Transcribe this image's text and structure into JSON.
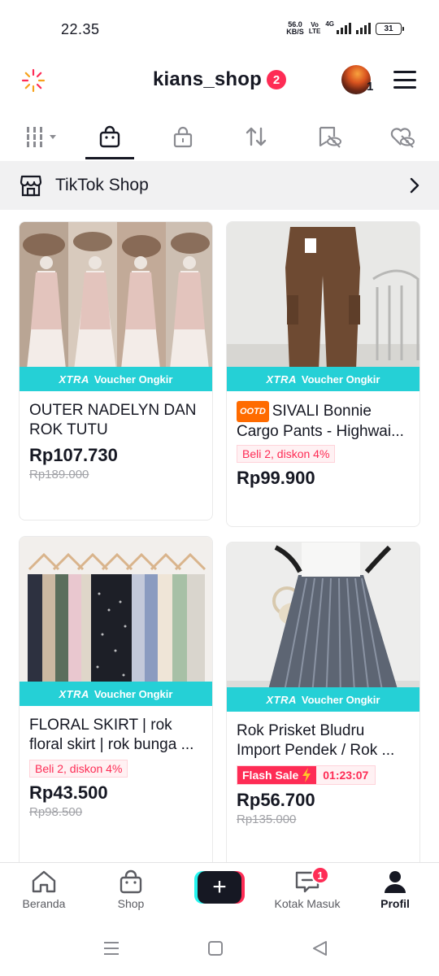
{
  "status_bar": {
    "time": "22.35",
    "net_speed_value": "56.0",
    "net_speed_unit": "KB/S",
    "volte_top": "Vo",
    "volte_bottom": "LTE",
    "network": "4G",
    "battery": "31"
  },
  "header": {
    "title": "kians_shop",
    "notification_count": "2",
    "account_count": "1"
  },
  "tabs": [
    {
      "icon": "grid-icon"
    },
    {
      "icon": "shopping-bag-icon",
      "active": true
    },
    {
      "icon": "lock-icon"
    },
    {
      "icon": "repost-icon"
    },
    {
      "icon": "favorites-hidden-icon"
    },
    {
      "icon": "liked-hidden-icon"
    }
  ],
  "shop_row": {
    "label": "TikTok Shop",
    "icon": "storefront-icon"
  },
  "voucher": {
    "xtra": "XTRA",
    "text": "Voucher Ongkir"
  },
  "products": [
    {
      "title": "OUTER NADELYN DAN ROK TUTU",
      "price": "Rp107.730",
      "original_price": "Rp189.000"
    },
    {
      "tag": "OOTD",
      "title": "SIVALI Bonnie Cargo Pants - Highwai...",
      "promo": "Beli 2, diskon 4%",
      "price": "Rp99.900"
    },
    {
      "title": "FLORAL SKIRT | rok floral skirt | rok bunga ...",
      "promo": "Beli 2, diskon 4%",
      "price": "Rp43.500",
      "original_price": "Rp98.500"
    },
    {
      "title": "Rok Prisket Bludru Import Pendek / Rok ...",
      "flash_label": "Flash Sale",
      "flash_timer": "01:23:07",
      "price": "Rp56.700",
      "original_price": "Rp135.000"
    }
  ],
  "bottom_nav": {
    "home": "Beranda",
    "shop": "Shop",
    "create": "+",
    "inbox": "Kotak Masuk",
    "inbox_badge": "1",
    "profile": "Profil"
  },
  "colors": {
    "accent": "#fe2c55",
    "voucher": "#25d0d6",
    "text": "#161823",
    "muted": "#a1a2a7"
  }
}
